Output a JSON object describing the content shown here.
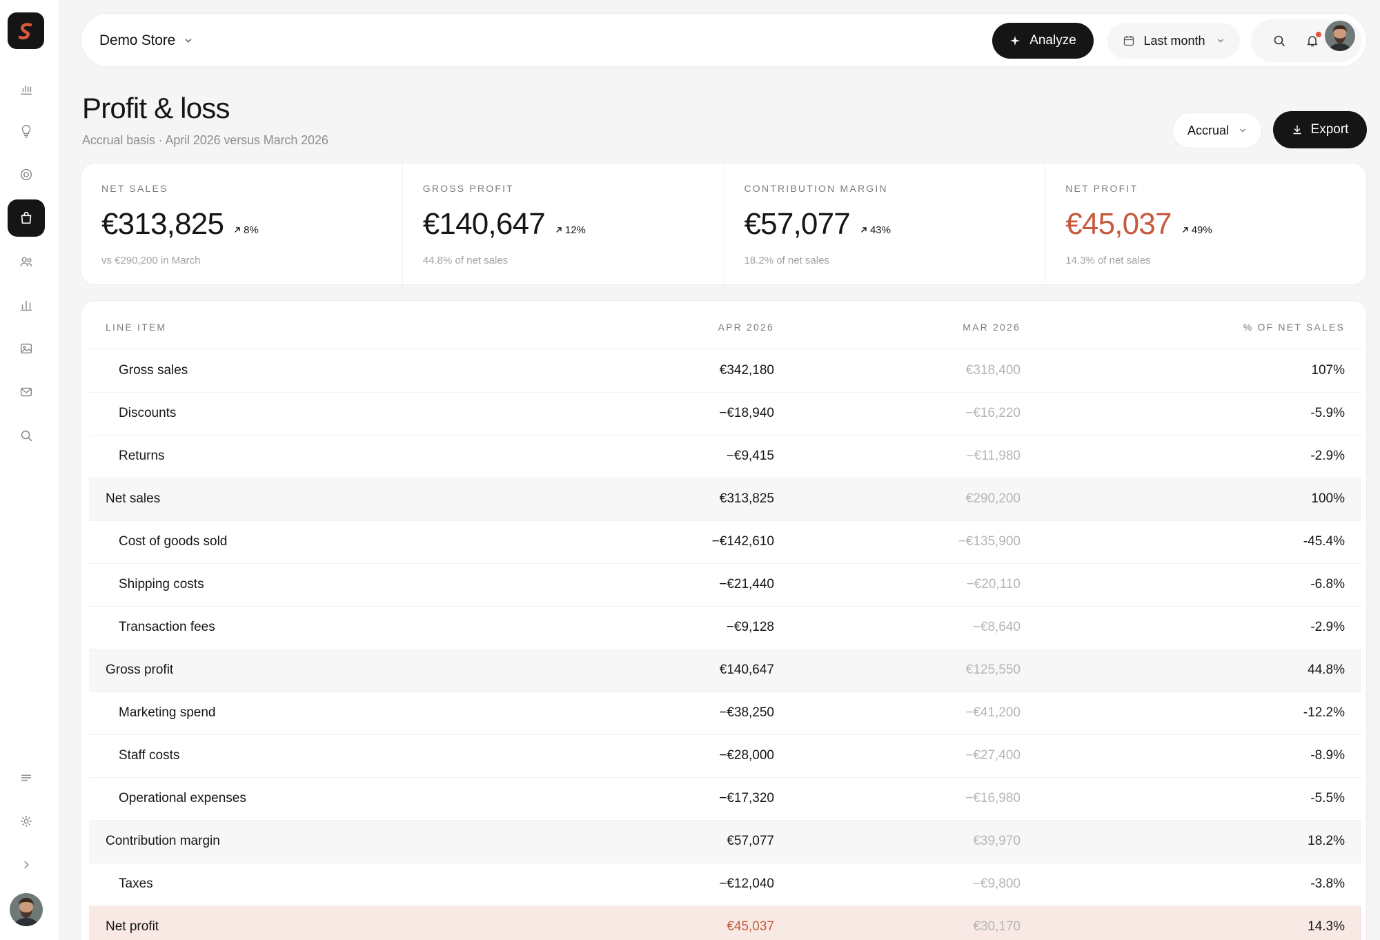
{
  "topbar": {
    "store_name": "Demo Store",
    "analyze_label": "Analyze",
    "period_label": "Last month"
  },
  "page": {
    "title": "Profit & loss",
    "subtitle": "Accrual basis · April 2026 versus March 2026",
    "basis_select": "Accrual",
    "export_label": "Export"
  },
  "kpis": [
    {
      "label": "NET SALES",
      "value": "€313,825",
      "delta": "8%",
      "note": "vs €290,200 in March"
    },
    {
      "label": "GROSS PROFIT",
      "value": "€140,647",
      "delta": "12%",
      "note": "44.8% of net sales"
    },
    {
      "label": "CONTRIBUTION MARGIN",
      "value": "€57,077",
      "delta": "43%",
      "note": "18.2% of net sales"
    },
    {
      "label": "NET PROFIT",
      "value": "€45,037",
      "delta": "49%",
      "note": "14.3% of net sales"
    }
  ],
  "table": {
    "headers": {
      "item": "LINE ITEM",
      "apr": "APR 2026",
      "mar": "MAR 2026",
      "pct": "% OF NET SALES"
    },
    "rows": [
      {
        "item": "Gross sales",
        "apr": "€342,180",
        "mar": "€318,400",
        "pct": "107%"
      },
      {
        "item": "Discounts",
        "apr": "−€18,940",
        "mar": "−€16,220",
        "pct": "-5.9%"
      },
      {
        "item": "Returns",
        "apr": "−€9,415",
        "mar": "−€11,980",
        "pct": "-2.9%"
      },
      {
        "item": "Net sales",
        "apr": "€313,825",
        "mar": "€290,200",
        "pct": "100%"
      },
      {
        "item": "Cost of goods sold",
        "apr": "−€142,610",
        "mar": "−€135,900",
        "pct": "-45.4%"
      },
      {
        "item": "Shipping costs",
        "apr": "−€21,440",
        "mar": "−€20,110",
        "pct": "-6.8%"
      },
      {
        "item": "Transaction fees",
        "apr": "−€9,128",
        "mar": "−€8,640",
        "pct": "-2.9%"
      },
      {
        "item": "Gross profit",
        "apr": "€140,647",
        "mar": "€125,550",
        "pct": "44.8%"
      },
      {
        "item": "Marketing spend",
        "apr": "−€38,250",
        "mar": "−€41,200",
        "pct": "-12.2%"
      },
      {
        "item": "Staff costs",
        "apr": "−€28,000",
        "mar": "−€27,400",
        "pct": "-8.9%"
      },
      {
        "item": "Operational expenses",
        "apr": "−€17,320",
        "mar": "−€16,980",
        "pct": "-5.5%"
      },
      {
        "item": "Contribution margin",
        "apr": "€57,077",
        "mar": "€39,970",
        "pct": "18.2%"
      },
      {
        "item": "Taxes",
        "apr": "−€12,040",
        "mar": "−€9,800",
        "pct": "-3.8%"
      },
      {
        "item": "Net profit",
        "apr": "€45,037",
        "mar": "€30,170",
        "pct": "14.3%"
      }
    ]
  },
  "colors": {
    "accent": "#c55a3d",
    "dark": "#151515",
    "net_row_bg": "#f8e9e4",
    "notification": "#e0553a"
  },
  "icons": {
    "sidebar": [
      "bar-chart-icon",
      "lightbulb-icon",
      "target-icon",
      "shopping-bag-icon",
      "users-icon",
      "analytics-icon",
      "image-icon",
      "mail-icon",
      "search-icon",
      "menu-icon",
      "settings-icon",
      "chevron-right-icon"
    ],
    "topbar": [
      "sparkle-icon",
      "calendar-icon",
      "search-icon",
      "bell-icon"
    ]
  }
}
